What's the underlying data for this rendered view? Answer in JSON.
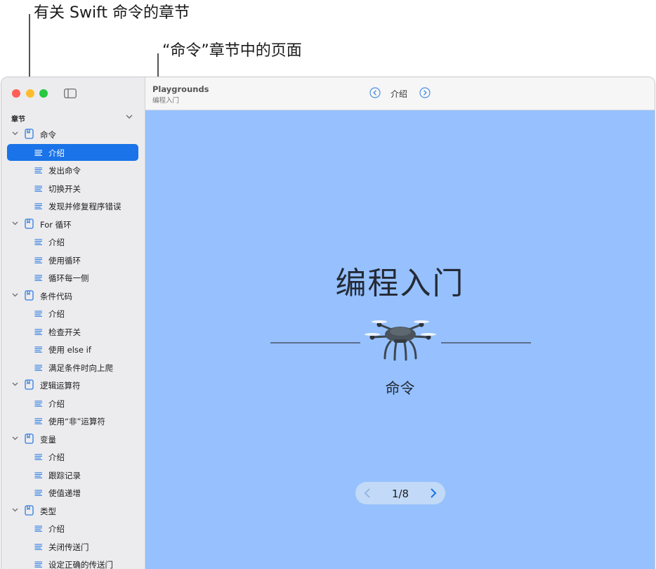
{
  "callouts": {
    "chapter_label": "有关 Swift 命令的章节",
    "pages_label": "“命令”章节中的页面"
  },
  "sidebar": {
    "header": "章节",
    "chapters": [
      {
        "title": "命令",
        "pages": [
          "介绍",
          "发出命令",
          "切换开关",
          "发现并修复程序错误"
        ]
      },
      {
        "title": "For 循环",
        "pages": [
          "介绍",
          "使用循环",
          "循环每一侧"
        ]
      },
      {
        "title": "条件代码",
        "pages": [
          "介绍",
          "检查开关",
          "使用 else if",
          "满足条件时向上爬"
        ]
      },
      {
        "title": "逻辑运算符",
        "pages": [
          "介绍",
          "使用“非”运算符"
        ]
      },
      {
        "title": "变量",
        "pages": [
          "介绍",
          "跟踪记录",
          "使值递增"
        ]
      },
      {
        "title": "类型",
        "pages": [
          "介绍",
          "关闭传送门",
          "设定正确的传送门"
        ]
      }
    ]
  },
  "toolbar": {
    "title": "Playgrounds",
    "subtitle": "编程入门",
    "current_page": "介绍"
  },
  "content": {
    "title": "编程入门",
    "chapter": "命令",
    "pager": "1/8"
  },
  "colors": {
    "accent": "#1a73e8",
    "content_bg": "#96c1fe",
    "sidebar_bg": "#ececee"
  }
}
